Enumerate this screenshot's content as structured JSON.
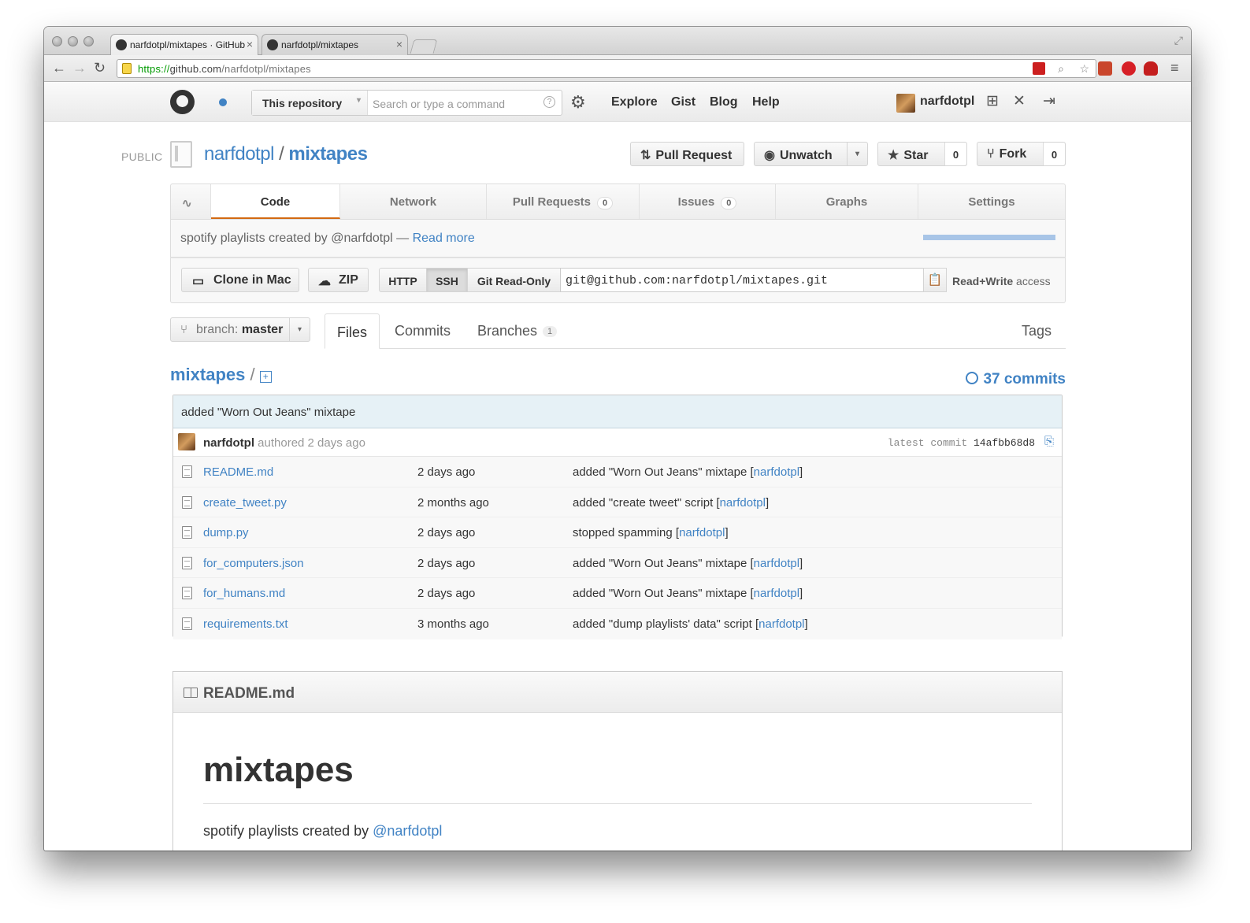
{
  "browser": {
    "tabs": [
      {
        "title": "narfdotpl/mixtapes · GitHub",
        "active": true
      },
      {
        "title": "narfdotpl/mixtapes",
        "active": false
      }
    ],
    "url_scheme": "https://",
    "url_host": "github.com",
    "url_path": "/narfdotpl/mixtapes"
  },
  "header": {
    "search_scope": "This repository",
    "search_placeholder": "Search or type a command",
    "nav": [
      "Explore",
      "Gist",
      "Blog",
      "Help"
    ],
    "username": "narfdotpl"
  },
  "repo": {
    "visibility": "PUBLIC",
    "owner": "narfdotpl",
    "separator": "/",
    "name": "mixtapes",
    "pull_request_label": "Pull Request",
    "unwatch_label": "Unwatch",
    "star_label": "Star",
    "star_count": "0",
    "fork_label": "Fork",
    "fork_count": "0"
  },
  "repo_nav": {
    "code": "Code",
    "network": "Network",
    "pull_requests": "Pull Requests",
    "pull_requests_count": "0",
    "issues": "Issues",
    "issues_count": "0",
    "graphs": "Graphs",
    "settings": "Settings"
  },
  "description": {
    "text": "spotify playlists created by @narfdotpl — ",
    "read_more": "Read more"
  },
  "clone": {
    "clone_mac": "Clone in Mac",
    "zip": "ZIP",
    "protocols": [
      "HTTP",
      "SSH",
      "Git Read-Only"
    ],
    "selected_protocol": "SSH",
    "url": "git@github.com:narfdotpl/mixtapes.git",
    "access_strong": "Read+Write",
    "access_rest": " access"
  },
  "files_nav": {
    "branch_prefix": "branch: ",
    "branch": "master",
    "tabs": [
      "Files",
      "Commits",
      "Branches"
    ],
    "branches_count": "1",
    "tags": "Tags"
  },
  "breadcrumb": {
    "root": "mixtapes",
    "sep": " / "
  },
  "commits_count_label": "37 commits",
  "latest_commit": {
    "message": "added \"Worn Out Jeans\" mixtape",
    "author": "narfdotpl",
    "authored": " authored 2 days ago",
    "label": "latest commit ",
    "sha": "14afbb68d8"
  },
  "files": [
    {
      "name": "README.md",
      "age": "2 days ago",
      "message": "added \"Worn Out Jeans\" mixtape [",
      "author": "narfdotpl"
    },
    {
      "name": "create_tweet.py",
      "age": "2 months ago",
      "message": "added \"create tweet\" script [",
      "author": "narfdotpl"
    },
    {
      "name": "dump.py",
      "age": "2 days ago",
      "message": "stopped spamming [",
      "author": "narfdotpl"
    },
    {
      "name": "for_computers.json",
      "age": "2 days ago",
      "message": "added \"Worn Out Jeans\" mixtape [",
      "author": "narfdotpl"
    },
    {
      "name": "for_humans.md",
      "age": "2 days ago",
      "message": "added \"Worn Out Jeans\" mixtape [",
      "author": "narfdotpl"
    },
    {
      "name": "requirements.txt",
      "age": "3 months ago",
      "message": "added \"dump playlists' data\" script [",
      "author": "narfdotpl"
    }
  ],
  "readme": {
    "filename": "README.md",
    "heading": "mixtapes",
    "paragraph": "spotify playlists created by ",
    "mention": "@narfdotpl"
  },
  "colors": {
    "link": "#4183c4",
    "selected_tab_underline": "#d26911",
    "commit_bar": "#e6f1f6"
  }
}
